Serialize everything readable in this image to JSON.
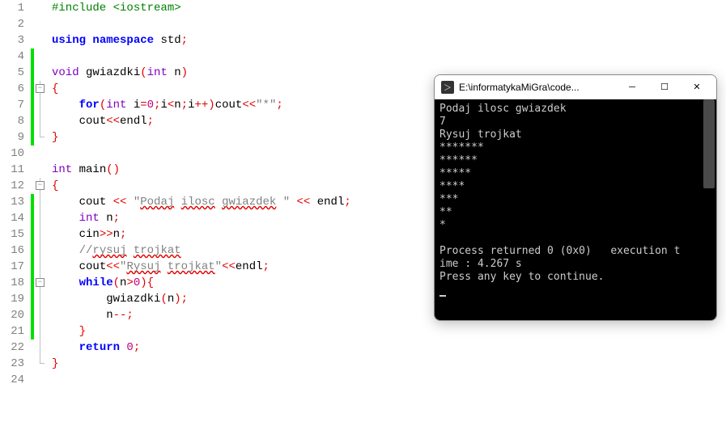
{
  "editor": {
    "lines": [
      {
        "n": 1,
        "tokens": [
          {
            "t": "#include ",
            "c": "inc"
          },
          {
            "t": "<iostream>",
            "c": "hdr"
          }
        ]
      },
      {
        "n": 2,
        "tokens": []
      },
      {
        "n": 3,
        "tokens": [
          {
            "t": "using ",
            "c": "kw"
          },
          {
            "t": "namespace ",
            "c": "kw"
          },
          {
            "t": "std",
            "c": "endl"
          },
          {
            "t": ";",
            "c": "op"
          }
        ]
      },
      {
        "n": 4,
        "tokens": [],
        "change": true
      },
      {
        "n": 5,
        "tokens": [
          {
            "t": "void ",
            "c": "type"
          },
          {
            "t": "gwiazdki",
            "c": ""
          },
          {
            "t": "(",
            "c": "paren"
          },
          {
            "t": "int ",
            "c": "type"
          },
          {
            "t": "n",
            "c": ""
          },
          {
            "t": ")",
            "c": "paren"
          }
        ],
        "change": true
      },
      {
        "n": 6,
        "tokens": [
          {
            "t": "{",
            "c": "brace"
          }
        ],
        "fold": true,
        "change": true,
        "tree": true
      },
      {
        "n": 7,
        "tokens": [
          {
            "t": "    ",
            "c": ""
          },
          {
            "t": "for",
            "c": "kw"
          },
          {
            "t": "(",
            "c": "paren"
          },
          {
            "t": "int ",
            "c": "type"
          },
          {
            "t": "i",
            "c": ""
          },
          {
            "t": "=",
            "c": "op"
          },
          {
            "t": "0",
            "c": "num"
          },
          {
            "t": ";",
            "c": "op"
          },
          {
            "t": "i",
            "c": ""
          },
          {
            "t": "<",
            "c": "op"
          },
          {
            "t": "n",
            "c": ""
          },
          {
            "t": ";",
            "c": "op"
          },
          {
            "t": "i",
            "c": ""
          },
          {
            "t": "++)",
            "c": "paren"
          },
          {
            "t": "cout",
            "c": ""
          },
          {
            "t": "<<",
            "c": "op"
          },
          {
            "t": "\"*\"",
            "c": "str"
          },
          {
            "t": ";",
            "c": "op"
          }
        ],
        "change": true,
        "tree": true
      },
      {
        "n": 8,
        "tokens": [
          {
            "t": "    ",
            "c": ""
          },
          {
            "t": "cout",
            "c": ""
          },
          {
            "t": "<<",
            "c": "op"
          },
          {
            "t": "endl",
            "c": "endl"
          },
          {
            "t": ";",
            "c": "op"
          }
        ],
        "change": true,
        "tree": true
      },
      {
        "n": 9,
        "tokens": [
          {
            "t": "}",
            "c": "brace"
          }
        ],
        "change": true,
        "treeend": true
      },
      {
        "n": 10,
        "tokens": []
      },
      {
        "n": 11,
        "tokens": [
          {
            "t": "int ",
            "c": "type"
          },
          {
            "t": "main",
            "c": ""
          },
          {
            "t": "()",
            "c": "paren"
          }
        ]
      },
      {
        "n": 12,
        "tokens": [
          {
            "t": "{",
            "c": "brace"
          }
        ],
        "fold": true,
        "tree": true
      },
      {
        "n": 13,
        "tokens": [
          {
            "t": "    ",
            "c": ""
          },
          {
            "t": "cout ",
            "c": ""
          },
          {
            "t": "<< ",
            "c": "op"
          },
          {
            "t": "\"",
            "c": "str"
          },
          {
            "t": "Podaj",
            "c": "str spell"
          },
          {
            "t": " ",
            "c": "str"
          },
          {
            "t": "ilosc",
            "c": "str spell"
          },
          {
            "t": " ",
            "c": "str"
          },
          {
            "t": "gwiazdek",
            "c": "str spell"
          },
          {
            "t": " \"",
            "c": "str"
          },
          {
            "t": " << ",
            "c": "op"
          },
          {
            "t": "endl",
            "c": "endl"
          },
          {
            "t": ";",
            "c": "op"
          }
        ],
        "change": true,
        "tree": true
      },
      {
        "n": 14,
        "tokens": [
          {
            "t": "    ",
            "c": ""
          },
          {
            "t": "int ",
            "c": "type"
          },
          {
            "t": "n",
            "c": ""
          },
          {
            "t": ";",
            "c": "op"
          }
        ],
        "change": true,
        "tree": true
      },
      {
        "n": 15,
        "tokens": [
          {
            "t": "    ",
            "c": ""
          },
          {
            "t": "cin",
            "c": ""
          },
          {
            "t": ">>",
            "c": "op"
          },
          {
            "t": "n",
            "c": ""
          },
          {
            "t": ";",
            "c": "op"
          }
        ],
        "change": true,
        "tree": true
      },
      {
        "n": 16,
        "tokens": [
          {
            "t": "    ",
            "c": ""
          },
          {
            "t": "//",
            "c": "comment"
          },
          {
            "t": "rysuj",
            "c": "comment spell"
          },
          {
            "t": " ",
            "c": "comment"
          },
          {
            "t": "trojkat",
            "c": "comment spell"
          }
        ],
        "change": true,
        "tree": true
      },
      {
        "n": 17,
        "tokens": [
          {
            "t": "    ",
            "c": ""
          },
          {
            "t": "cout",
            "c": ""
          },
          {
            "t": "<<",
            "c": "op"
          },
          {
            "t": "\"",
            "c": "str"
          },
          {
            "t": "Rysuj",
            "c": "str spell"
          },
          {
            "t": " ",
            "c": "str"
          },
          {
            "t": "trojkat",
            "c": "str spell"
          },
          {
            "t": "\"",
            "c": "str"
          },
          {
            "t": "<<",
            "c": "op"
          },
          {
            "t": "endl",
            "c": "endl"
          },
          {
            "t": ";",
            "c": "op"
          }
        ],
        "change": true,
        "tree": true
      },
      {
        "n": 18,
        "tokens": [
          {
            "t": "    ",
            "c": ""
          },
          {
            "t": "while",
            "c": "kw"
          },
          {
            "t": "(",
            "c": "paren"
          },
          {
            "t": "n",
            "c": ""
          },
          {
            "t": ">",
            "c": "op"
          },
          {
            "t": "0",
            "c": "num"
          },
          {
            "t": "){",
            "c": "paren"
          }
        ],
        "change": true,
        "tree": true,
        "fold2": true
      },
      {
        "n": 19,
        "tokens": [
          {
            "t": "        ",
            "c": ""
          },
          {
            "t": "gwiazdki",
            "c": ""
          },
          {
            "t": "(",
            "c": "paren"
          },
          {
            "t": "n",
            "c": ""
          },
          {
            "t": ");",
            "c": "paren"
          }
        ],
        "change": true,
        "tree": true
      },
      {
        "n": 20,
        "tokens": [
          {
            "t": "        ",
            "c": ""
          },
          {
            "t": "n",
            "c": ""
          },
          {
            "t": "--;",
            "c": "op"
          }
        ],
        "change": true,
        "tree": true
      },
      {
        "n": 21,
        "tokens": [
          {
            "t": "    ",
            "c": ""
          },
          {
            "t": "}",
            "c": "brace"
          }
        ],
        "change": true,
        "tree": true
      },
      {
        "n": 22,
        "tokens": [
          {
            "t": "    ",
            "c": ""
          },
          {
            "t": "return ",
            "c": "kw"
          },
          {
            "t": "0",
            "c": "num"
          },
          {
            "t": ";",
            "c": "op"
          }
        ],
        "tree": true
      },
      {
        "n": 23,
        "tokens": [
          {
            "t": "}",
            "c": "brace"
          }
        ],
        "treeend": true
      },
      {
        "n": 24,
        "tokens": []
      }
    ]
  },
  "console": {
    "title": "E:\\informatykaMiGra\\code...",
    "lines": [
      "Podaj ilosc gwiazdek",
      "7",
      "Rysuj trojkat",
      "*******",
      "******",
      "*****",
      "****",
      "***",
      "**",
      "*",
      "",
      "Process returned 0 (0x0)   execution t",
      "ime : 4.267 s",
      "Press any key to continue."
    ]
  }
}
